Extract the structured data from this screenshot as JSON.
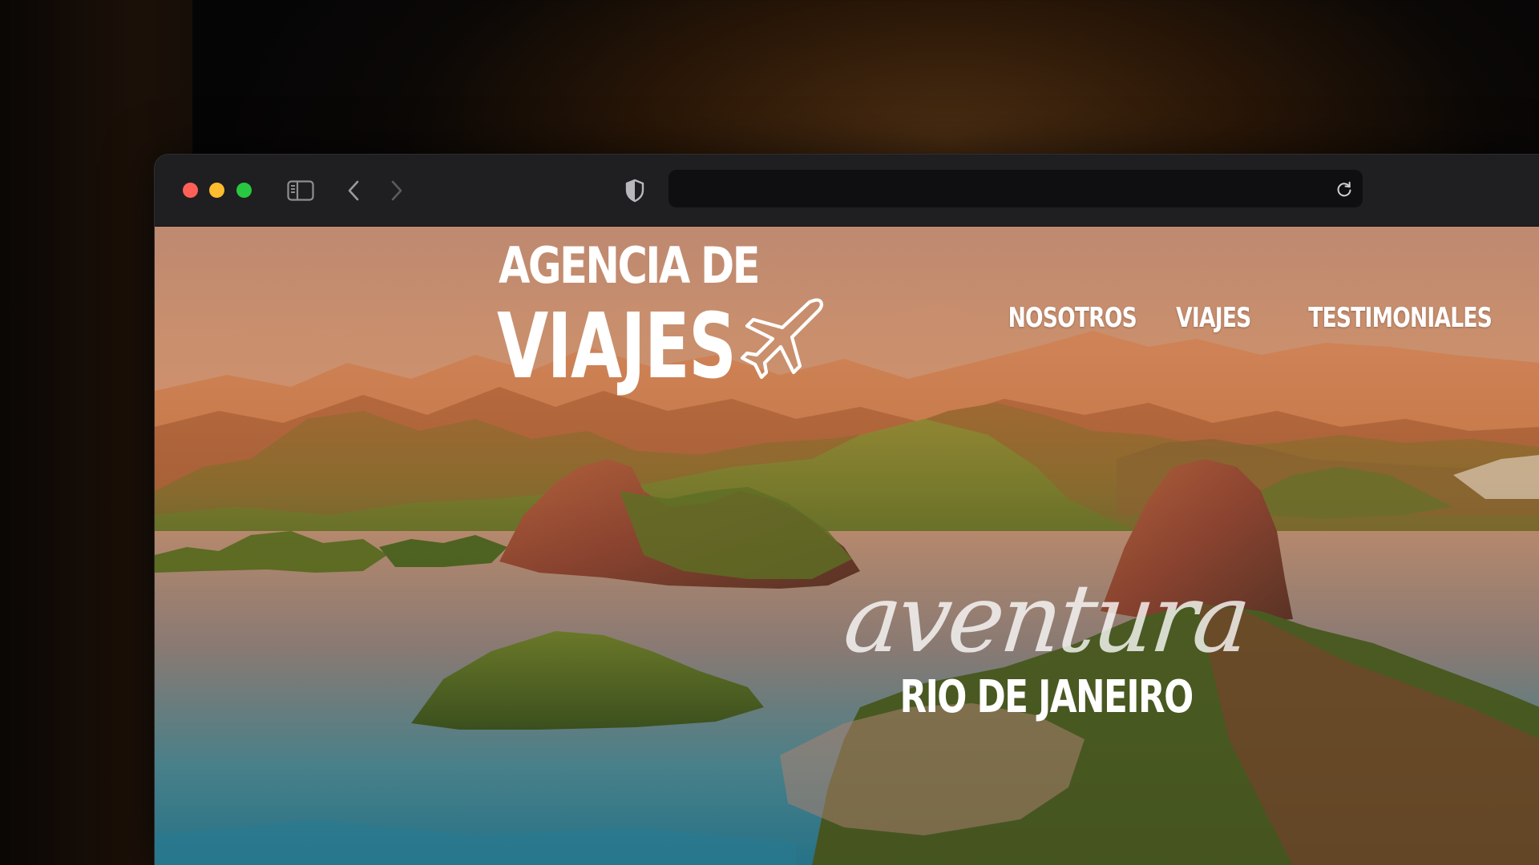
{
  "browser": {
    "url": "",
    "url_placeholder": "",
    "icons": {
      "sidebar": "sidebar-icon",
      "back": "chevron-left-icon",
      "forward": "chevron-right-icon",
      "privacy": "shield-icon",
      "reload": "reload-icon"
    },
    "traffic_light_colors": {
      "close": "#fe5f57",
      "minimize": "#febc2e",
      "maximize": "#28c840"
    }
  },
  "site": {
    "logo": {
      "line1": "AGENCIA DE",
      "line2": "VIAJES",
      "icon": "airplane-icon"
    },
    "nav": {
      "items": [
        {
          "label": "NOSOTROS"
        },
        {
          "label": "VIAJES"
        },
        {
          "label": "TESTIMONIALES"
        }
      ]
    },
    "hero": {
      "tagline": "aventura",
      "destination": "RIO DE JANEIRO"
    }
  }
}
